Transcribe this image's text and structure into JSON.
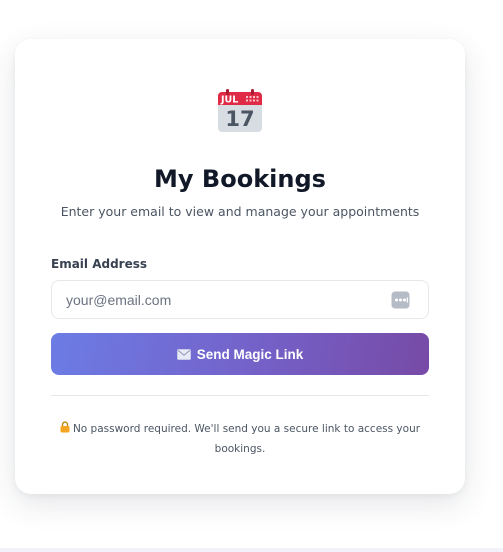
{
  "card": {
    "icon": "calendar-icon",
    "calendar_month": "JUL",
    "calendar_day": "17",
    "title": "My Bookings",
    "subtitle": "Enter your email to view and manage your appointments"
  },
  "form": {
    "email_label": "Email Address",
    "email_value": "",
    "email_placeholder": "your@email.com",
    "autofill_icon": "autofill-icon",
    "submit_icon": "envelope-icon",
    "submit_label": "Send Magic Link"
  },
  "footer_note": {
    "icon": "lock-icon",
    "text": "No password required. We'll send you a secure link to access your bookings."
  },
  "colors": {
    "button_gradient_start": "#6c7ce5",
    "button_gradient_end": "#774aa6",
    "calendar_red": "#e02b46",
    "lock_gold": "#f4a522",
    "title_text": "#111827"
  }
}
